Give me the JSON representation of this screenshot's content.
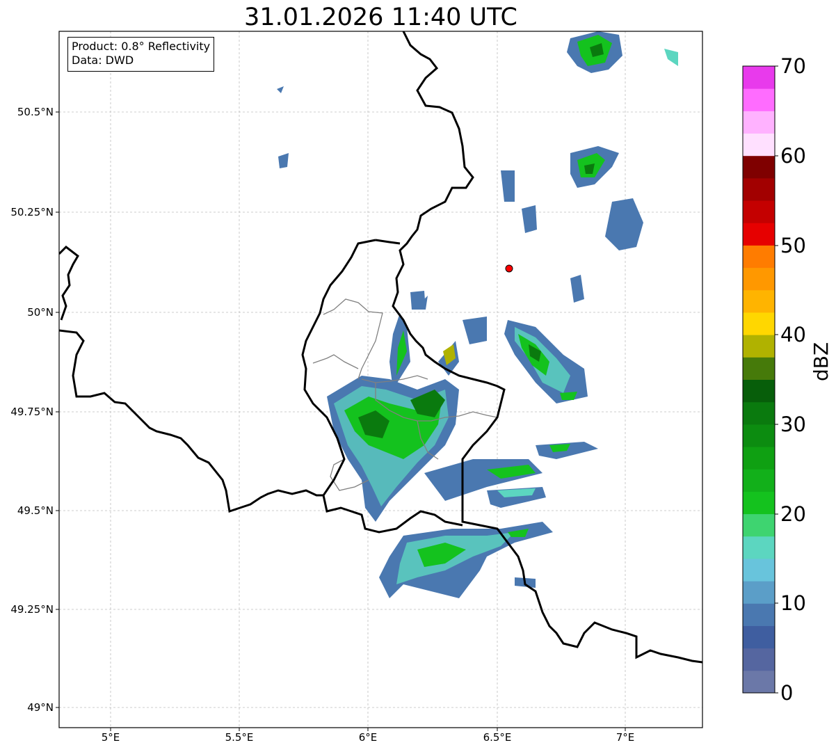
{
  "title": "31.01.2026 11:40 UTC",
  "infobox": {
    "product": "Product: 0.8° Reflectivity",
    "source": "Data: DWD"
  },
  "axes": {
    "lat_ticks": [
      "50.5°N",
      "50.25°N",
      "50°N",
      "49.75°N",
      "49.5°N",
      "49.25°N",
      "49°N"
    ],
    "lon_ticks": [
      "5°E",
      "5.5°E",
      "6°E",
      "6.5°E",
      "7°E"
    ],
    "lat_range": [
      48.95,
      50.7
    ],
    "lon_range": [
      4.8,
      7.3
    ]
  },
  "colorbar": {
    "label": "dBZ",
    "ticks": [
      "0",
      "10",
      "20",
      "30",
      "40",
      "50",
      "60",
      "70"
    ],
    "range": [
      0,
      70
    ],
    "colors": [
      "#6b78a8",
      "#5566a0",
      "#3f5ea0",
      "#4a78b0",
      "#5b9ec8",
      "#68c4dc",
      "#5cd6c0",
      "#3ed470",
      "#14c21e",
      "#12b01a",
      "#0fa012",
      "#0c8c10",
      "#0a7a0e",
      "#075e0a",
      "#467a0a",
      "#b0b200",
      "#ffd700",
      "#ffb400",
      "#ff9800",
      "#ff7c00",
      "#e60000",
      "#c40000",
      "#a20000",
      "#7f0000",
      "#ffe0ff",
      "#ffb2ff",
      "#ff6cff",
      "#e83aec"
    ]
  },
  "radar_site": {
    "lon": 6.548,
    "lat": 50.109,
    "color": "#ff0000"
  },
  "grid": "on",
  "borders_color": "#000000",
  "admin_borders_color": "#808080"
}
